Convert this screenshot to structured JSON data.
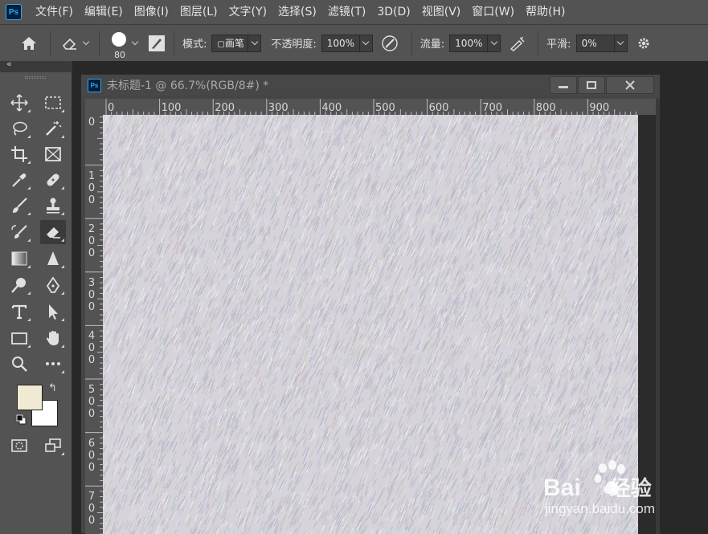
{
  "app": {
    "logo_text": "Ps",
    "menu": [
      "文件(F)",
      "编辑(E)",
      "图像(I)",
      "图层(L)",
      "文字(Y)",
      "选择(S)",
      "滤镜(T)",
      "3D(D)",
      "视图(V)",
      "窗口(W)",
      "帮助(H)"
    ]
  },
  "options": {
    "brush_size": "80",
    "mode_label": "模式:",
    "mode_value": "画笔",
    "opacity_label": "不透明度:",
    "opacity_value": "100%",
    "flow_label": "流量:",
    "flow_value": "100%",
    "smooth_label": "平滑:",
    "smooth_value": "0%"
  },
  "toolbar": {
    "collapse_glyph": "«",
    "swap_glyph": "↰",
    "foreground_color": "#f0ead2",
    "background_color": "#ffffff",
    "tools": [
      "move-icon",
      "marquee-icon",
      "lasso-icon",
      "magic-wand-icon",
      "crop-icon",
      "frame-icon",
      "eyedropper-icon",
      "healing-icon",
      "brush-icon",
      "stamp-icon",
      "history-brush-icon",
      "eraser-icon",
      "gradient-icon",
      "blur-icon",
      "dodge-icon",
      "pen-icon",
      "type-icon",
      "path-select-icon",
      "rectangle-icon",
      "hand-icon",
      "zoom-icon",
      "more-icon",
      "quick-mask-icon",
      "screen-mode-icon"
    ],
    "active_tool": "eraser-icon"
  },
  "document": {
    "icon_text": "Ps",
    "title": "未标题-1 @ 66.7%(RGB/8#) *",
    "ruler_h": [
      "0",
      "100",
      "200",
      "300",
      "400",
      "500",
      "600",
      "700",
      "800",
      "900"
    ],
    "ruler_v": [
      "0",
      "100",
      "200",
      "300",
      "400",
      "500",
      "600",
      "700"
    ],
    "canvas_color": "#d6d4da"
  },
  "watermark": {
    "brand": "Bai",
    "brand_suffix": "经验",
    "url": "jingyan.baidu.com"
  }
}
